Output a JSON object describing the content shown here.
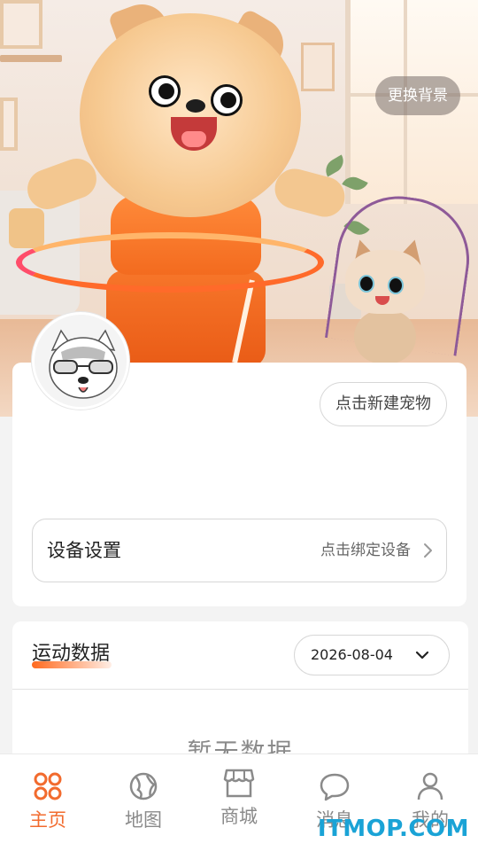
{
  "header": {
    "change_background_label": "更换背景"
  },
  "profile": {
    "new_pet_label": "点击新建宠物"
  },
  "device": {
    "title": "设备设置",
    "hint": "点击绑定设备"
  },
  "sport": {
    "title": "运动数据",
    "date": "2026-08-04",
    "empty_text": "暂无数据"
  },
  "tabbar": {
    "items": [
      {
        "label": "主页",
        "icon": "home-grid-icon",
        "active": true
      },
      {
        "label": "地图",
        "icon": "map-icon",
        "active": false
      },
      {
        "label": "商城",
        "icon": "shop-icon",
        "active": false
      },
      {
        "label": "消息",
        "icon": "message-icon",
        "active": false
      },
      {
        "label": "我的",
        "icon": "user-icon",
        "active": false
      }
    ]
  },
  "watermark": "ITMOP.COM",
  "colors": {
    "accent": "#f26b2e",
    "inactive": "#8a8a8a",
    "watermark": "#1aa3d6"
  }
}
